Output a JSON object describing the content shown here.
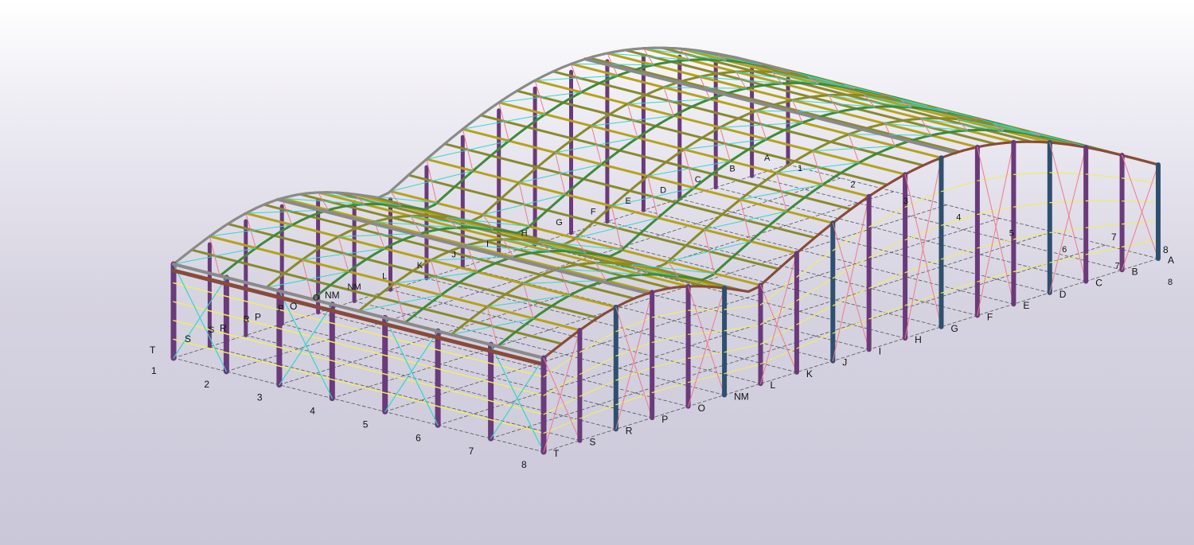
{
  "viewer": {
    "background_top": "#ffffff",
    "background_bottom": "#cac7d9"
  },
  "colors": {
    "column": "#6b3a7a",
    "column_dark": "#2f4f6f",
    "purlin": "#b5a21a",
    "rafter_green": "#3f8a3a",
    "rafter_olive": "#8a8a2a",
    "bracing_cyan": "#35d6c8",
    "bracing_pink": "#f07a8a",
    "girt_yellow": "#f2ea6a",
    "eave_beam": "#8a4a3a",
    "grid_line": "#555555",
    "ridge": "#8a8a8a"
  },
  "grid": {
    "front_numbers": [
      "1",
      "2",
      "3",
      "4",
      "5",
      "6",
      "7",
      "8"
    ],
    "front_letters": [
      "T",
      "S",
      "R",
      "P",
      "O",
      "NM",
      "L",
      "K",
      "J",
      "I",
      "H",
      "G",
      "F",
      "E",
      "D",
      "C",
      "B",
      "A"
    ],
    "left_letters": [
      "T",
      "S",
      "R",
      "P",
      "O",
      "NM"
    ],
    "right_numbers": [
      "7",
      "8"
    ],
    "roof_letters": [
      "A",
      "B",
      "C",
      "D",
      "E",
      "F",
      "G",
      "H",
      "I",
      "J",
      "K",
      "L",
      "NM",
      "O",
      "P",
      "R",
      "S"
    ],
    "roof_numbers": [
      "1",
      "2",
      "3",
      "4",
      "5",
      "6",
      "7",
      "8"
    ]
  }
}
